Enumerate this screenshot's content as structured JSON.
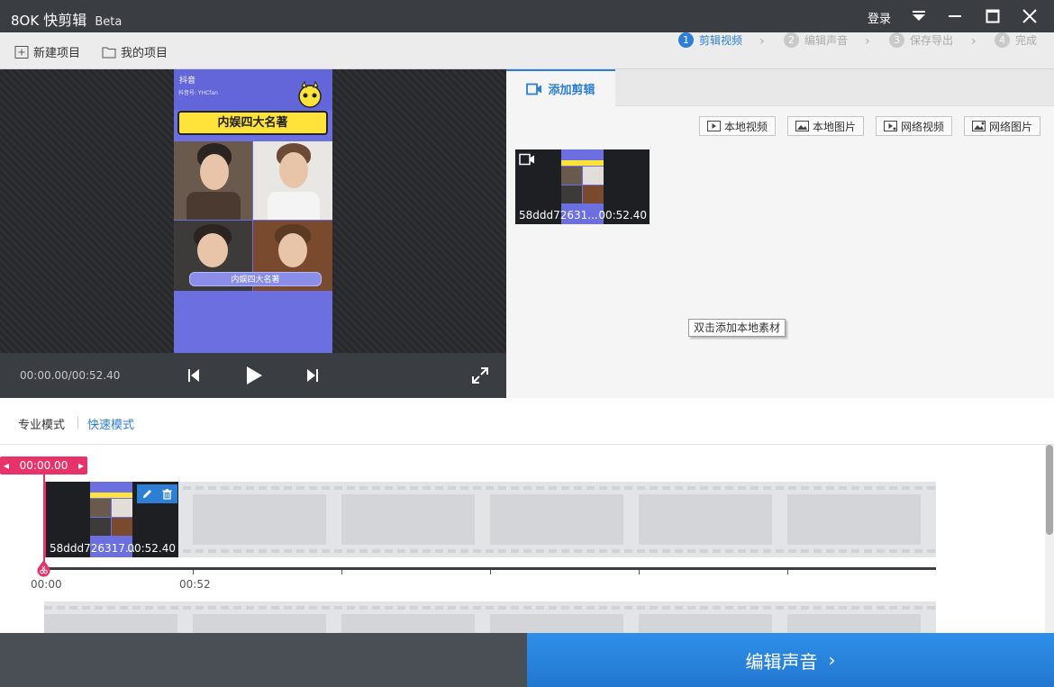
{
  "app": {
    "name": "快剪辑",
    "brand_mark": "8OK",
    "edition": "Beta",
    "login_label": "登录"
  },
  "toolbar": {
    "new_project": "新建项目",
    "my_projects": "我的项目"
  },
  "steps": [
    {
      "num": "1",
      "label": "剪辑视频",
      "active": true
    },
    {
      "num": "2",
      "label": "编辑声音",
      "active": false
    },
    {
      "num": "3",
      "label": "保存导出",
      "active": false
    },
    {
      "num": "4",
      "label": "完成",
      "active": false
    }
  ],
  "preview": {
    "timecode": "00:00.00/00:52.40",
    "video": {
      "tiktok_label": "抖音",
      "account": "抖音号: YHCfan",
      "banner_text": "内娱四大名著",
      "caption": "内娱四大名著"
    }
  },
  "media_panel": {
    "tab_label": "添加剪辑",
    "buttons": [
      "本地视频",
      "本地图片",
      "网络视频",
      "网络图片"
    ],
    "clip": {
      "name": "58ddd72631...",
      "duration": "00:52.40"
    },
    "tooltip": "双击添加本地素材"
  },
  "modes": {
    "pro": "专业模式",
    "fast": "快速模式"
  },
  "timeline": {
    "playhead_time": "00:00.00",
    "clip": {
      "name": "58ddd726317...",
      "duration": "00:52.40"
    },
    "ticks": [
      "00:00",
      "00:52"
    ]
  },
  "footer": {
    "next_label": "编辑声音"
  },
  "colors": {
    "accent": "#2d7fd6",
    "playhead": "#e8336a",
    "titlebar": "#3a3d42"
  }
}
